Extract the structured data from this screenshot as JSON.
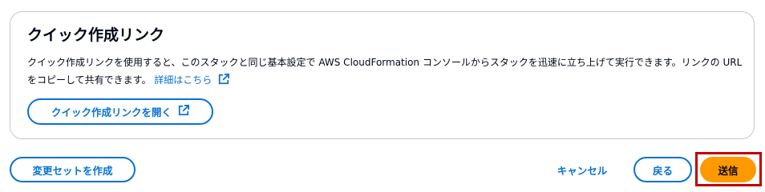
{
  "card": {
    "title": "クイック作成リンク",
    "description": "クイック作成リンクを使用すると、このスタックと同じ基本設定で AWS CloudFormation コンソールからスタックを迅速に立ち上げて実行できます。リンクの URL をコピーして共有できます。",
    "learn_more_label": "詳細はこちら",
    "learn_more_icon": "external-link-icon",
    "open_button_label": "クイック作成リンクを開く",
    "open_button_icon": "external-link-icon"
  },
  "footer": {
    "change_set_label": "変更セットを作成",
    "cancel_label": "キャンセル",
    "back_label": "戻る",
    "submit_label": "送信"
  },
  "colors": {
    "link": "#0972d3",
    "primary": "#ff9900",
    "highlight": "#c00000",
    "border": "#c6c6cd"
  }
}
